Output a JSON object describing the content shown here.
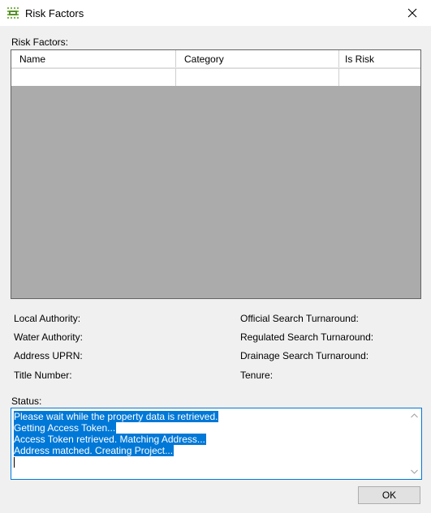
{
  "window": {
    "title": "Risk Factors"
  },
  "grid": {
    "label": "Risk Factors:",
    "columns": [
      "Name",
      "Category",
      "Is Risk"
    ],
    "rows": [
      [
        "",
        "",
        ""
      ]
    ]
  },
  "info": {
    "local_authority": "Local Authority:",
    "water_authority": "Water Authority:",
    "address_uprn": "Address UPRN:",
    "title_number": "Title Number:",
    "official_search": "Official Search Turnaround:",
    "regulated_search": "Regulated Search Turnaround:",
    "drainage_search": "Drainage Search Turnaround:",
    "tenure": "Tenure:"
  },
  "status": {
    "label": "Status:",
    "lines": [
      "Please wait while the property data is retrieved.",
      "Getting Access Token...",
      "Access Token retrieved. Matching Address...",
      "Address matched. Creating Project..."
    ]
  },
  "buttons": {
    "ok": "OK"
  },
  "icons": {
    "app": "app-icon",
    "close": "close-icon"
  },
  "colors": {
    "selection": "#0078d7",
    "grid_background": "#ababab"
  }
}
